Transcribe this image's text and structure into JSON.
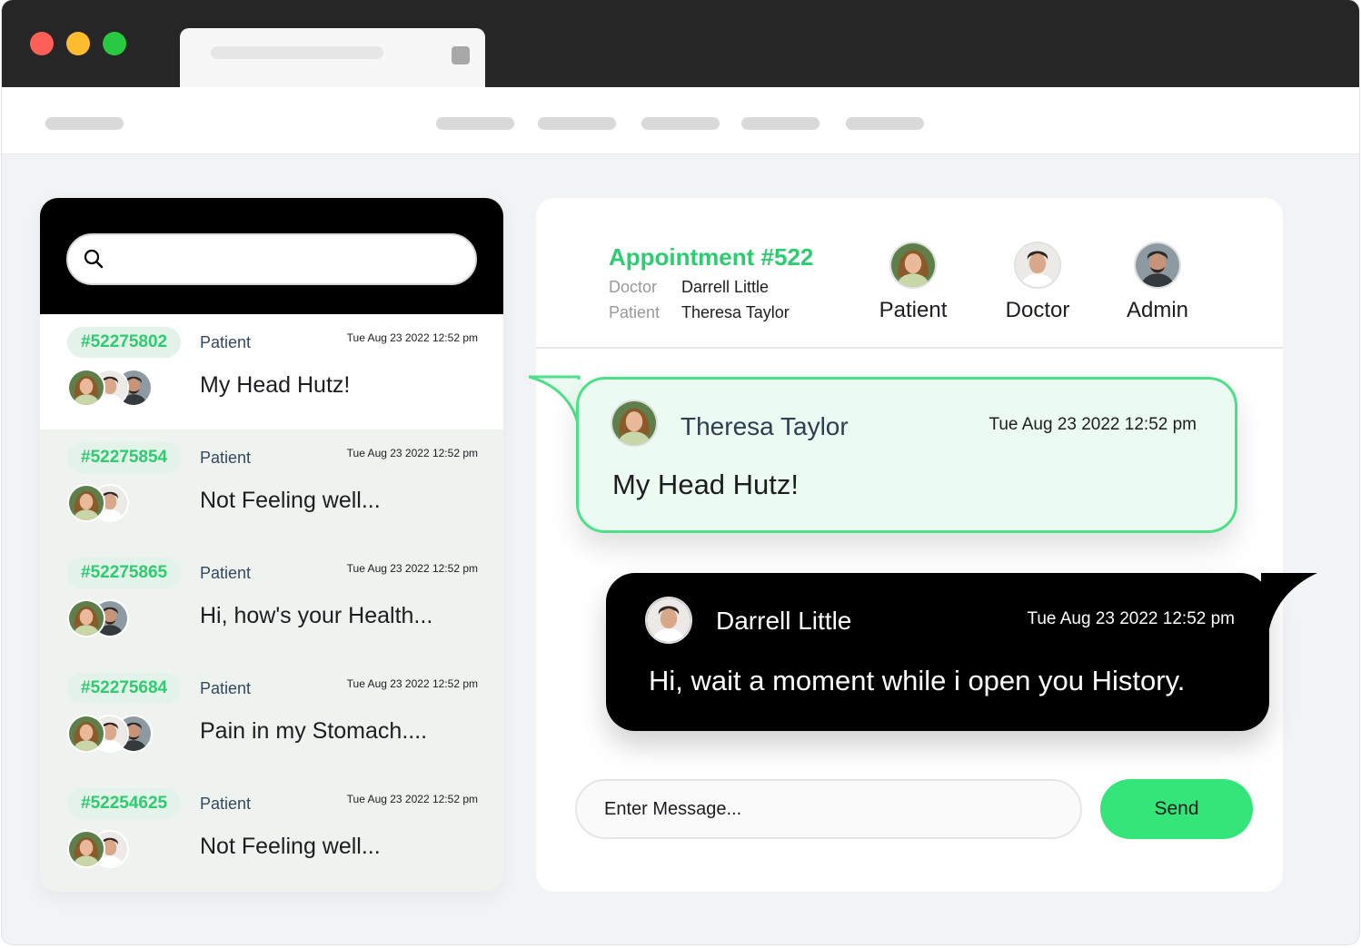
{
  "colors": {
    "accent": "#2ecc71",
    "accent_soft": "#ecfbf1",
    "send": "#34e57a",
    "dark": "#000000"
  },
  "search": {
    "placeholder": ""
  },
  "conversations": [
    {
      "id": "#52275802",
      "role": "Patient",
      "time": "Tue Aug 23 2022 12:52 pm",
      "preview": "My Head Hutz!",
      "avatars": [
        "patient",
        "doctor",
        "admin"
      ],
      "active": true
    },
    {
      "id": "#52275854",
      "role": "Patient",
      "time": "Tue Aug 23 2022 12:52 pm",
      "preview": "Not Feeling well...",
      "avatars": [
        "patient",
        "doctor"
      ]
    },
    {
      "id": "#52275865",
      "role": "Patient",
      "time": "Tue Aug 23 2022 12:52 pm",
      "preview": "Hi, how's your Health...",
      "avatars": [
        "patient",
        "admin"
      ]
    },
    {
      "id": "#52275684",
      "role": "Patient",
      "time": "Tue Aug 23 2022 12:52 pm",
      "preview": "Pain in my Stomach....",
      "avatars": [
        "patient",
        "doctor",
        "admin"
      ]
    },
    {
      "id": "#52254625",
      "role": "Patient",
      "time": "Tue Aug 23 2022 12:52 pm",
      "preview": "Not Feeling well...",
      "avatars": [
        "patient",
        "doctor"
      ]
    }
  ],
  "appointment": {
    "title": "Appointment #522",
    "doctor_key": "Doctor",
    "doctor_name": "Darrell Little",
    "patient_key": "Patient",
    "patient_name": "Theresa Taylor"
  },
  "participants": [
    {
      "label": "Patient",
      "avatar": "patient"
    },
    {
      "label": "Doctor",
      "avatar": "doctor"
    },
    {
      "label": "Admin",
      "avatar": "admin"
    }
  ],
  "messages": [
    {
      "sender": "Theresa Taylor",
      "time": "Tue Aug 23 2022 12:52 pm",
      "text": "My Head Hutz!",
      "direction": "incoming",
      "avatar": "patient"
    },
    {
      "sender": "Darrell Little",
      "time": "Tue Aug 23 2022 12:52 pm",
      "text": "Hi, wait a moment while i open you History.",
      "direction": "outgoing",
      "avatar": "doctor"
    }
  ],
  "composer": {
    "placeholder": "Enter Message...",
    "send_label": "Send"
  }
}
